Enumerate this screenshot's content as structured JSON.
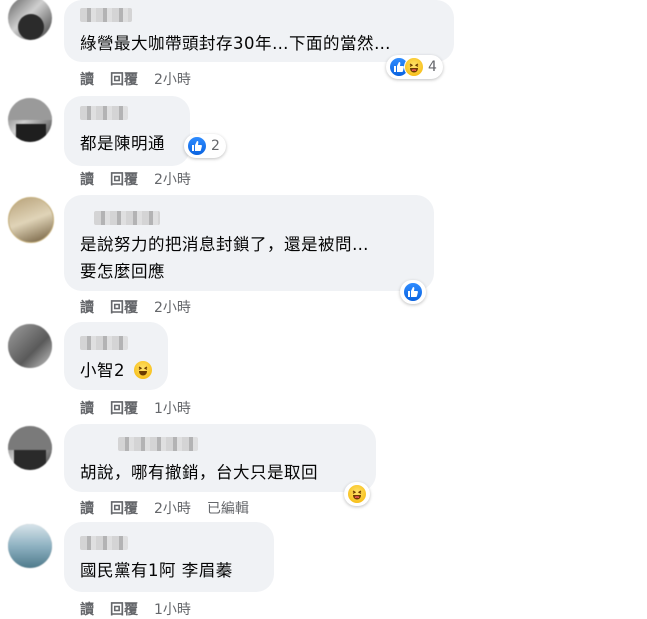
{
  "colors": {
    "bubble": "#f0f2f5",
    "meta": "#65676b",
    "like": "#1877f2",
    "haha": "#f7b928"
  },
  "comments": [
    {
      "text_lines": [
        "綠營最大咖帶頭封存30年…下面的當然…"
      ],
      "read": "讀",
      "reply": "回覆",
      "time": "2小時",
      "reactions": [
        "like-icon",
        "haha-icon"
      ],
      "reaction_count": "4"
    },
    {
      "text_lines": [
        "都是陳明通"
      ],
      "read": "讀",
      "reply": "回覆",
      "time": "2小時",
      "reactions": [
        "like-icon"
      ],
      "reaction_count": "2"
    },
    {
      "text_lines": [
        "是說努力的把消息封鎖了，還是被問…",
        "要怎麼回應"
      ],
      "read": "讀",
      "reply": "回覆",
      "time": "2小時",
      "reactions": [
        "like-icon"
      ],
      "reaction_count": ""
    },
    {
      "text_lines": [
        "小智2"
      ],
      "read": "讀",
      "reply": "回覆",
      "time": "1小時",
      "reactions": [],
      "reaction_count": ""
    },
    {
      "text_lines": [
        "胡說，哪有撤銷，台大只是取回"
      ],
      "read": "讀",
      "reply": "回覆",
      "time": "2小時",
      "edited": "已編輯",
      "reactions": [
        "haha-icon"
      ],
      "reaction_count": ""
    },
    {
      "text_lines": [
        "國民黨有1阿 李眉蓁"
      ],
      "read": "讀",
      "reply": "回覆",
      "time": "1小時",
      "reactions": [],
      "reaction_count": ""
    }
  ]
}
